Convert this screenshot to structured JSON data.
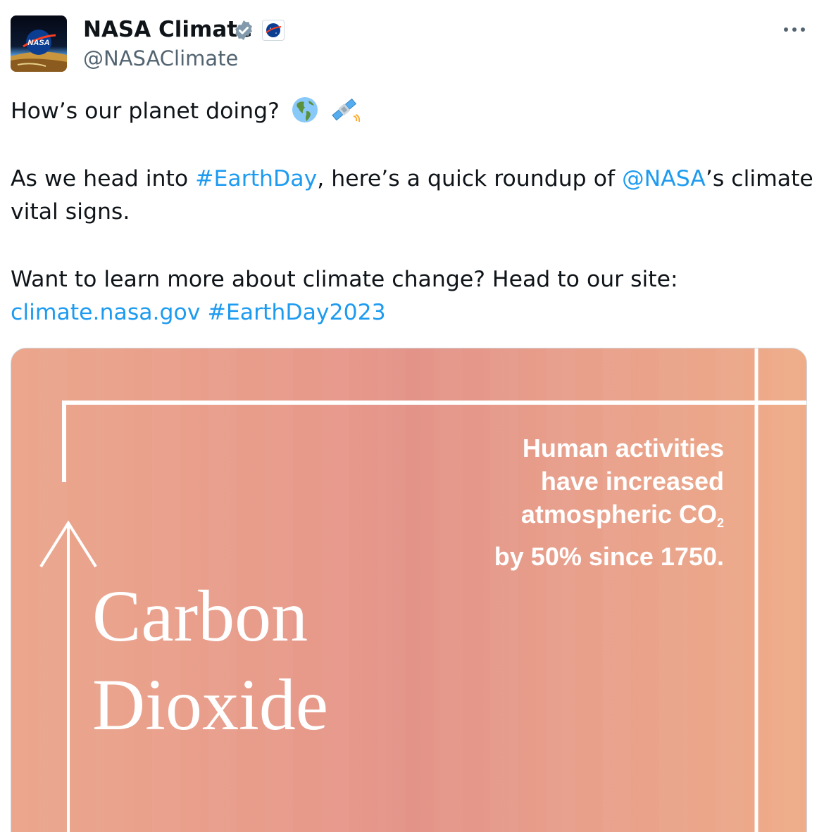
{
  "author": {
    "name": "NASA Climate",
    "handle": "@NASAClimate",
    "avatar_logo_text": "NASA",
    "verified_color": "#829aab"
  },
  "tweet": {
    "line1": "How’s our planet doing?",
    "line1_emojis": [
      "globe-americas-icon",
      "satellite-icon"
    ],
    "p2_before_tag": "As we head into ",
    "p2_tag": "#EarthDay",
    "p2_middle": ", here’s a quick roundup of ",
    "p2_mention": "@NASA",
    "p2_after": "’s climate",
    "p2_line2": "vital signs.",
    "p3_line1": "Want to learn more about climate change? Head to our site:",
    "p3_link": "climate.nasa.gov",
    "p3_tag": "#EarthDay2023"
  },
  "media": {
    "fact_line1": "Human activities",
    "fact_line2": "have increased",
    "fact_line3": "atmospheric CO",
    "fact_line3_sub": "2",
    "fact_line4": "by 50% since 1750.",
    "headline_line1": "Carbon",
    "headline_line2": "Dioxide"
  },
  "colors": {
    "link": "#1d9bf0",
    "text": "#0f1419",
    "secondary": "#536471",
    "media_bg": "#e89c8a"
  }
}
